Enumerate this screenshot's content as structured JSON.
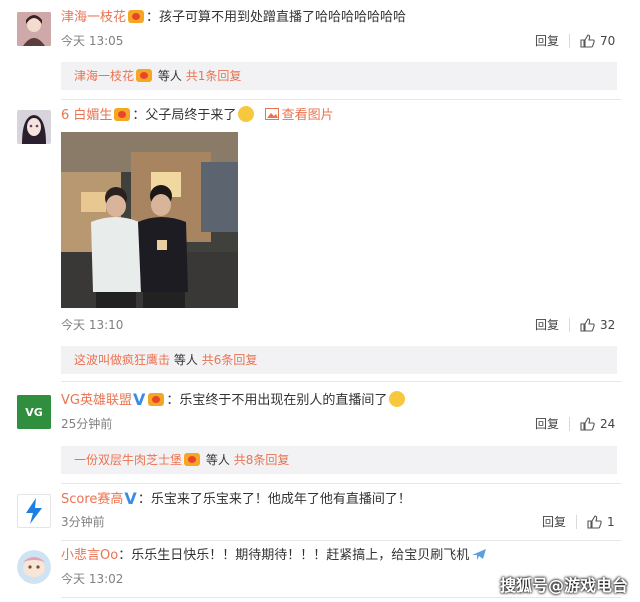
{
  "comments": [
    {
      "user": "津海一枝花",
      "text": "孩子可算不用到处蹭直播了哈哈哈哈哈哈哈",
      "time": "今天 13:05",
      "reply": "回复",
      "likes": "70",
      "replies": {
        "user": "津海一枝花",
        "mid": "等人",
        "count": "共1条回复"
      }
    },
    {
      "user": "6 白媚生",
      "text": "父子局终于来了",
      "view_image": "查看图片",
      "time": "今天 13:10",
      "reply": "回复",
      "likes": "32",
      "replies": {
        "user": "这波叫做疯狂鹰击",
        "mid": "等人",
        "count": "共6条回复"
      }
    },
    {
      "user": "VG英雄联盟",
      "text": "乐宝终于不用出现在别人的直播间了",
      "time": "25分钟前",
      "reply": "回复",
      "likes": "24",
      "avatar_text": "VG",
      "replies": {
        "user": "一份双层牛肉芝士堡",
        "mid": "等人",
        "count": "共8条回复"
      }
    },
    {
      "user": "Score赛高",
      "text": "乐宝来了乐宝来了！他成年了他有直播间了！",
      "time": "3分钟前",
      "reply": "回复",
      "likes": "1"
    },
    {
      "user": "小悲言Oo",
      "text": "乐乐生日快乐！！期待期待！！！赶紧搞上，给宝贝刷飞机",
      "time": "今天 13:02"
    }
  ],
  "colon": "：",
  "watermark": "搜狐号@游戏电台",
  "colors": {
    "name": "#eb7350",
    "bar": "#f2f2f5",
    "vblue": "#3a8ce6"
  }
}
